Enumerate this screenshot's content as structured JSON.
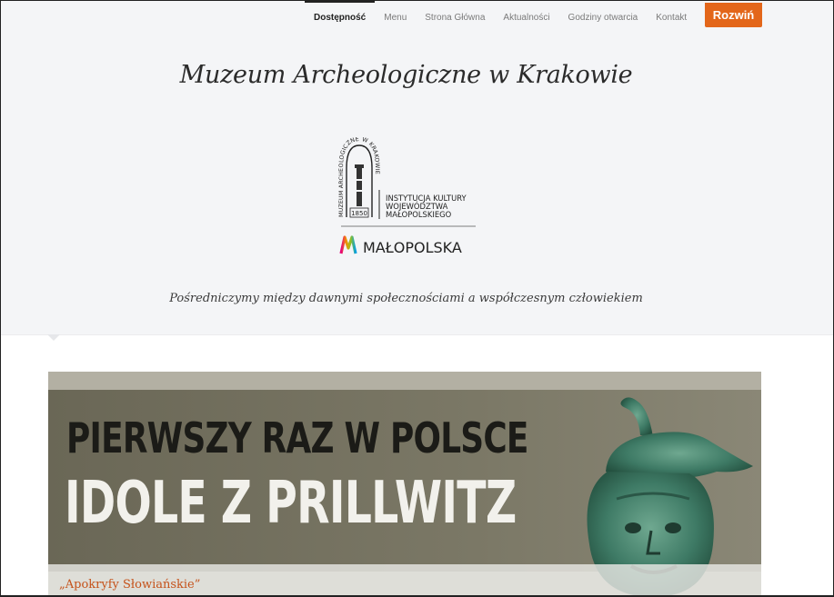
{
  "nav": {
    "items": [
      {
        "label": "Dostępność",
        "active": true
      },
      {
        "label": "Menu"
      },
      {
        "label": "Strona Główna"
      },
      {
        "label": "Aktualności"
      },
      {
        "label": "Godziny otwarcia"
      },
      {
        "label": "Kontakt"
      }
    ],
    "expand_label": "Rozwiń"
  },
  "site": {
    "title": "Muzeum Archeologiczne w Krakowie",
    "tagline": "Pośredniczymy między dawnymi społecznościami a współczesnym człowiekiem"
  },
  "logo": {
    "arch_text": "MUZEUM ARCHEOLOGICZNE W KRAKOWIE",
    "year": "1850",
    "institution_line1": "INSTYTUCJA KULTURY",
    "institution_line2": "WOJEWÓDZTWA",
    "institution_line3": "MAŁOPOLSKIEGO",
    "region": "MAŁOPOLSKA"
  },
  "banner": {
    "line1": "PIERWSZY RAZ W POLSCE",
    "line2": "IDOLE Z PRILLWITZ",
    "caption": "„Apokryfy Słowiańskie”"
  },
  "colors": {
    "accent": "#e3661a",
    "header_bg": "#f4f5f7",
    "caption": "#c5521a"
  }
}
